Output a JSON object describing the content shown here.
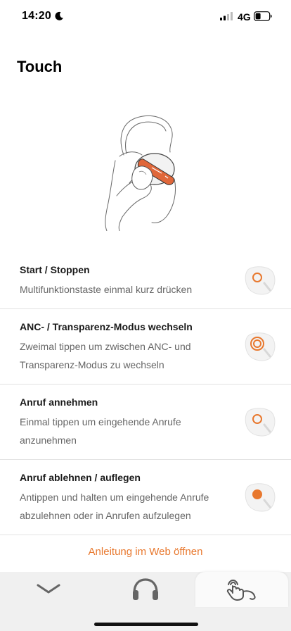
{
  "status_bar": {
    "time": "14:20",
    "network": "4G"
  },
  "page": {
    "title": "Touch"
  },
  "gestures": [
    {
      "title": "Start / Stoppen",
      "description": "Multifunktionstaste einmal kurz drücken",
      "icon": "single-tap-icon"
    },
    {
      "title": "ANC- / Transparenz-Modus wechseln",
      "description": "Zweimal tippen um zwischen ANC- und Transparenz-Modus zu wechseln",
      "icon": "double-tap-icon"
    },
    {
      "title": "Anruf annehmen",
      "description": "Einmal tippen um eingehende Anrufe anzunehmen",
      "icon": "single-tap-icon"
    },
    {
      "title": "Anruf ablehnen / auflegen",
      "description": "Antippen und halten um eingehende Anrufe abzulehnen oder in Anrufen aufzulegen",
      "icon": "tap-and-hold-icon"
    }
  ],
  "footer": {
    "web_guide_link": "Anleitung im Web öffnen"
  },
  "colors": {
    "accent": "#e8782e",
    "tab_bar": "#f0f0f0"
  },
  "bottom_nav": {
    "tabs": [
      "chevron-icon",
      "headphones-icon",
      "touch-gesture-icon"
    ],
    "active_index": 2
  }
}
